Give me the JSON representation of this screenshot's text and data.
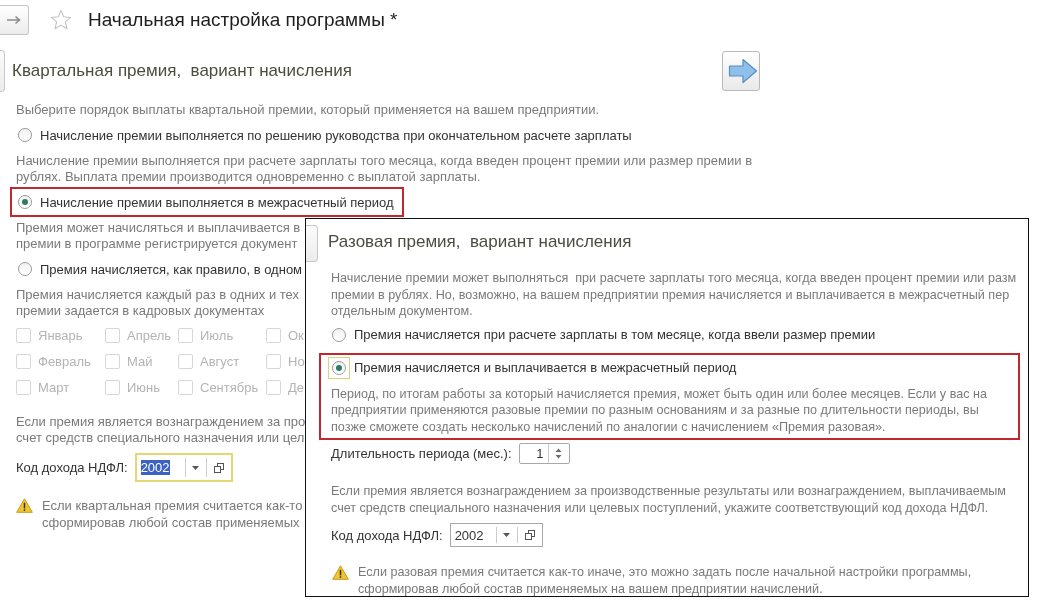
{
  "header": {
    "title": "Начальная настройка программы *"
  },
  "panels": [
    {
      "kind": "page",
      "title": "Квартальная премия,  вариант начисления",
      "next_button": true,
      "blocks": [
        {
          "kind": "text",
          "text": [
            "Выберите порядок выплаты квартальной премии, который применяется на вашем предприятии."
          ]
        },
        {
          "kind": "radio",
          "label": "Начисление премии выполняется по решению руководства при окончательном расчете зарплаты",
          "selected": false,
          "focused": false,
          "highlighted": false
        },
        {
          "kind": "text",
          "text": [
            "Начисление премии выполняется при расчете зарплаты того месяца, когда введен процент премии или размер премии в",
            "рублях. Выплата премии производится одновременно с выплатой зарплаты."
          ]
        },
        {
          "kind": "radio",
          "label": "Начисление премии выполняется в межрасчетный период",
          "selected": true,
          "focused": false,
          "highlighted": true
        },
        {
          "kind": "text",
          "text": [
            "Премия может начисляться и выплачивается в",
            "премии в программе регистрируется документ"
          ]
        },
        {
          "kind": "radio",
          "label": "Премия начисляется, как правило, в одном",
          "selected": false,
          "focused": false,
          "highlighted": false
        },
        {
          "kind": "text",
          "text": [
            "Премия начисляется каждый раз в одних и тех",
            "премии задается в кадровых документах"
          ]
        },
        {
          "kind": "checkboxes",
          "items": [
            {
              "label": "Январь",
              "checked": false,
              "disabled": true
            },
            {
              "label": "Апрель",
              "checked": false,
              "disabled": true
            },
            {
              "label": "Июль",
              "checked": false,
              "disabled": true
            },
            {
              "label": "Ок",
              "checked": false,
              "disabled": true
            },
            {
              "label": "Февраль",
              "checked": false,
              "disabled": true
            },
            {
              "label": "Май",
              "checked": false,
              "disabled": true
            },
            {
              "label": "Август",
              "checked": false,
              "disabled": true
            },
            {
              "label": "Но",
              "checked": false,
              "disabled": true
            },
            {
              "label": "Март",
              "checked": false,
              "disabled": true
            },
            {
              "label": "Июнь",
              "checked": false,
              "disabled": true
            },
            {
              "label": "Сентябрь",
              "checked": false,
              "disabled": true
            },
            {
              "label": "Де",
              "checked": false,
              "disabled": true
            }
          ]
        },
        {
          "kind": "text",
          "text": [
            "Если премия является вознаграждением за про",
            "счет средств специального назначения или цел"
          ]
        },
        {
          "kind": "field",
          "label": "Код дохода НДФЛ:",
          "value": "2002",
          "focused": true
        },
        {
          "kind": "warning",
          "text": [
            "Если квартальная премия считается как-то",
            "сформировав любой состав применяемых"
          ]
        }
      ]
    },
    {
      "kind": "overlay",
      "title": "Разовая премия,  вариант начисления",
      "blocks": [
        {
          "kind": "text",
          "text": [
            "Начисление премии может выполняться  при расчете зарплаты того месяца, когда введен процент премии или разм",
            "премии в рублях. Но, возможно, на вашем предприятии премия начисляется и выплачивается в межрасчетный пер",
            "отдельным документом."
          ]
        },
        {
          "kind": "radio",
          "label": "Премия начисляется при расчете зарплаты в том месяце, когда ввели размер премии",
          "selected": false,
          "focused": false,
          "highlighted": false
        },
        {
          "kind": "radio",
          "label": "Премия начисляется и выплачивается в межрасчетный период",
          "selected": true,
          "focused": true,
          "highlighted": true,
          "note": "Период, по итогам работы за который начисляется премия, может быть один или более месяцев. Если у вас на предприятии применяются разовые премии по разным основаниям и за разные по длительности периоды, вы позже сможете создать несколько начислений по аналогии с начислением «Премия разовая»."
        },
        {
          "kind": "spinner",
          "label": "Длительность периода (мес.):",
          "value": "1"
        },
        {
          "kind": "text",
          "text": [
            "Если премия является вознаграждением за производственные результаты или вознаграждением, выплачиваемым",
            "счет средств специального назначения или целевых поступлений, укажите соответствующий код дохода НДФЛ."
          ]
        },
        {
          "kind": "field",
          "label": "Код дохода НДФЛ:",
          "value": "2002",
          "focused": false
        },
        {
          "kind": "warning",
          "text": "Если разовая премия считается как-то иначе, это можно задать после начальной настройки программы, сформировав любой состав применяемых на вашем предприятии начислений."
        }
      ]
    }
  ]
}
